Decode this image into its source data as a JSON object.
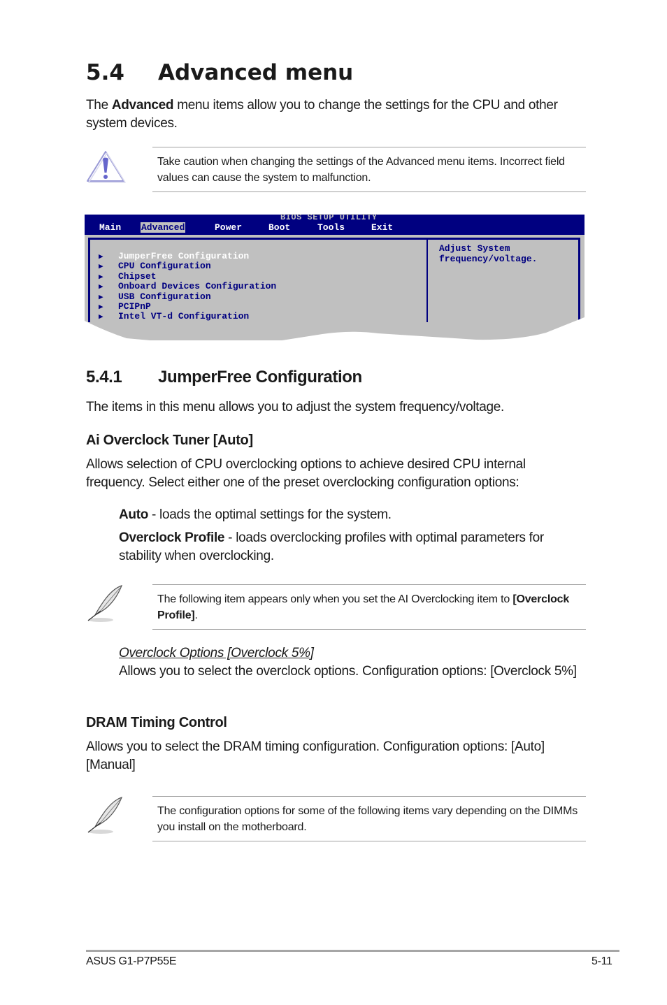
{
  "section": {
    "number": "5.4",
    "title": "Advanced menu",
    "intro_prefix": "The ",
    "intro_bold": "Advanced",
    "intro_rest": " menu items allow you to change the settings for the CPU and other system devices."
  },
  "caution": {
    "icon": "warning-triangle-icon",
    "text": "Take caution when changing the settings of the Advanced menu items. Incorrect field values can cause the system to malfunction."
  },
  "bios": {
    "title": "BIOS SETUP UTILITY",
    "menu": [
      {
        "label": "Main",
        "selected": false
      },
      {
        "label": "Advanced",
        "selected": true
      },
      {
        "label": "Power",
        "selected": false
      },
      {
        "label": "Boot",
        "selected": false
      },
      {
        "label": "Tools",
        "selected": false
      },
      {
        "label": "Exit",
        "selected": false
      }
    ],
    "items": [
      {
        "label": "JumperFree Configuration",
        "selected": true
      },
      {
        "label": "CPU Configuration",
        "selected": false
      },
      {
        "label": "Chipset",
        "selected": false
      },
      {
        "label": "Onboard Devices Configuration",
        "selected": false
      },
      {
        "label": "USB Configuration",
        "selected": false
      },
      {
        "label": "PCIPnP",
        "selected": false
      },
      {
        "label": "Intel VT-d Configuration",
        "selected": false
      }
    ],
    "help_text": "Adjust System\nfrequency/voltage.",
    "colors": {
      "header": "#000080",
      "panel": "#c0c0c0",
      "text": "#000080",
      "highlight": "#ffffff"
    }
  },
  "subsection": {
    "number": "5.4.1",
    "title": "JumperFree Configuration",
    "intro": "The items in this menu allows you to adjust the system frequency/voltage."
  },
  "ai_overclock": {
    "heading": "Ai Overclock Tuner [Auto]",
    "description": "Allows selection of CPU overclocking options to achieve desired CPU internal frequency. Select either one of the preset overclocking configuration options:",
    "options": [
      {
        "name": "Auto",
        "desc": " - loads the optimal settings for the system."
      },
      {
        "name": "Overclock Profile",
        "desc": " - loads overclocking profiles with optimal parameters for stability when overclocking."
      }
    ]
  },
  "note1": {
    "icon": "feather-pen-icon",
    "text": "The following item appears only when you set the AI Overclocking item to ",
    "bold": "[Overclock Profile]",
    "suffix": "."
  },
  "overclock_options": {
    "heading": "Overclock Options [Overclock 5%]",
    "description": "Allows you to select the overclock options. Configuration options: [Overclock 5%]"
  },
  "dram": {
    "heading": "DRAM Timing Control",
    "description": "Allows you to select the DRAM timing configuration. Configuration options: [Auto] [Manual]"
  },
  "note2": {
    "icon": "feather-pen-icon",
    "text": "The configuration options for some of the following items vary depending on the DIMMs you install on the motherboard."
  },
  "footer": {
    "product": "ASUS G1-P7P55E",
    "page": "5-11"
  }
}
